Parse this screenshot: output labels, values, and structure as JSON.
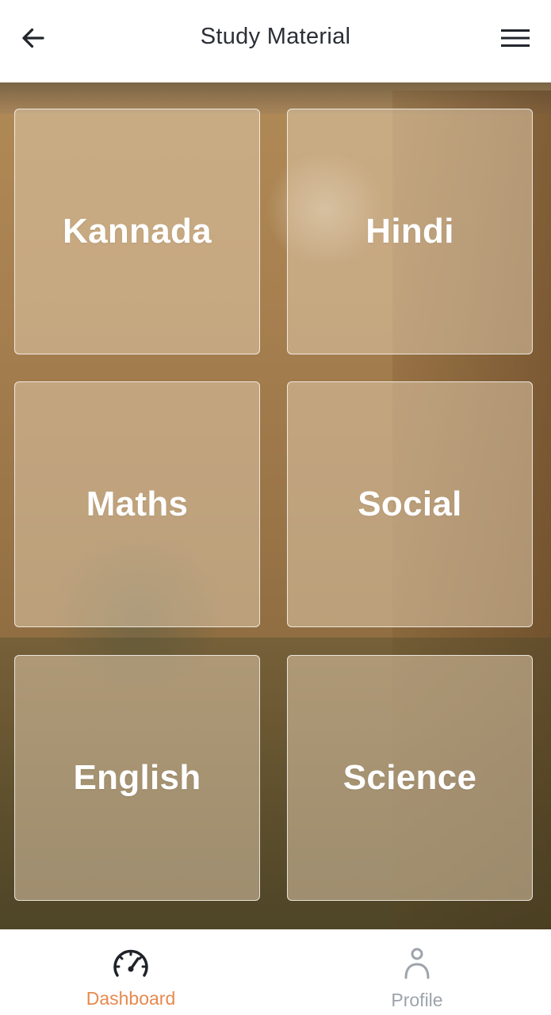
{
  "header": {
    "title": "Study Material",
    "back_icon": "arrow-left-icon",
    "menu_icon": "hamburger-menu-icon"
  },
  "subjects": [
    {
      "label": "Kannada"
    },
    {
      "label": "Hindi"
    },
    {
      "label": "Maths"
    },
    {
      "label": "Social"
    },
    {
      "label": "English"
    },
    {
      "label": "Science"
    }
  ],
  "bottom_nav": {
    "dashboard": {
      "label": "Dashboard",
      "icon": "speedometer-icon",
      "active": true
    },
    "profile": {
      "label": "Profile",
      "icon": "person-icon",
      "active": false
    }
  },
  "colors": {
    "accent": "#e8894d",
    "inactive": "#9ea3ab",
    "title_text": "#2b2f36",
    "tile_text": "#ffffff"
  }
}
